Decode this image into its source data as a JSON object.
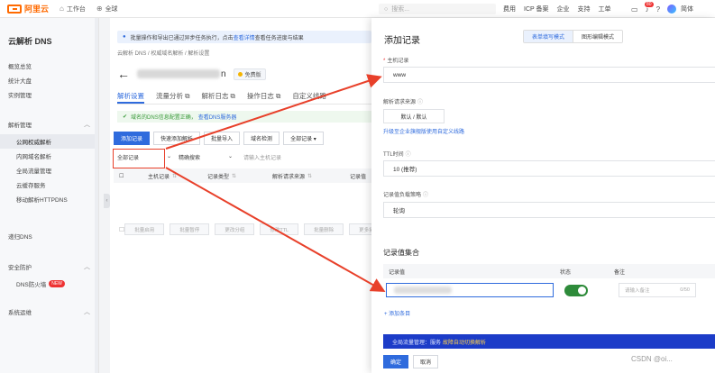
{
  "topbar": {
    "logo": "阿里云",
    "workbench": "工作台",
    "global": "全球",
    "search_placeholder": "搜索...",
    "links": [
      "费用",
      "ICP 备案",
      "企业",
      "支持",
      "工单"
    ],
    "notif_count": "80",
    "user": "简体"
  },
  "sidebar": {
    "title": "云解析 DNS",
    "items_top": [
      "概览总览",
      "统计大盘",
      "实例管理"
    ],
    "group_resolve": "解析管理",
    "sub_items": [
      "公网权威解析",
      "内网域名解析",
      "全局流量管理",
      "云缓存服务",
      "移动解析HTTPDNS"
    ],
    "group_recursive": "递归DNS",
    "group_security": "安全防护",
    "firewall": "DNS防火墙",
    "new_badge": "NEW",
    "group_ops": "系统运维"
  },
  "main": {
    "notice_text": "批量操作和导出已通过异步任务执行，点击",
    "notice_link": "查看详情",
    "notice_tail": "查看任务进度与结果",
    "breadcrumb": "云解析 DNS / 权威域名解析 / 解析设置",
    "domain_tail": "n",
    "plan": "免费版",
    "tabs": [
      "解析设置",
      "流量分析 ⧉",
      "解析日志 ⧉",
      "操作日志 ⧉",
      "自定义线路"
    ],
    "success_text": "域名的DNS信息配置正确，",
    "success_link": "查看DNS服务器",
    "toolbar": [
      "添加记录",
      "快速添加解析",
      "批量导入",
      "域名检测",
      "全部记录 ▾"
    ],
    "filter_select": "全部记录",
    "filter_mode": "精确搜索",
    "filter_input": "请输入主机记录",
    "columns": [
      "主机记录",
      "记录类型",
      "解析请求来源",
      "记录值"
    ],
    "footer_actions": [
      "批量启用",
      "批量暂停",
      "更改分组",
      "修改TTL",
      "批量删除",
      "更多操作"
    ]
  },
  "drawer": {
    "title": "添加记录",
    "mode_form": "表单填写模式",
    "mode_graph": "图形编辑模式",
    "host_label": "主机记录",
    "host_value": "www",
    "source_label": "解析请求来源",
    "source_value": "默认 / 默认",
    "source_link": "升级至企业旗舰版使用自定义线路",
    "ttl_label": "TTL时间",
    "ttl_value": "10 (推荐)",
    "strategy_label": "记录值负载策略",
    "strategy_value": "轮询",
    "set_title": "记录值集合",
    "col_value": "记录值",
    "col_status": "状态",
    "col_note": "备注",
    "note_placeholder": "请输入备注",
    "note_count": "0/50",
    "add_item": "+ 添加条目",
    "promo_text": "全局流量管理：服务",
    "promo_highlight": "故障自动切换解析",
    "confirm": "确定",
    "cancel": "取消"
  },
  "watermark": "CSDN @oi...",
  "colors": {
    "accent": "#2f6bdd",
    "brand": "#ff6a00",
    "annotation": "#e8402a",
    "toggle_on": "#2e8b3a"
  }
}
